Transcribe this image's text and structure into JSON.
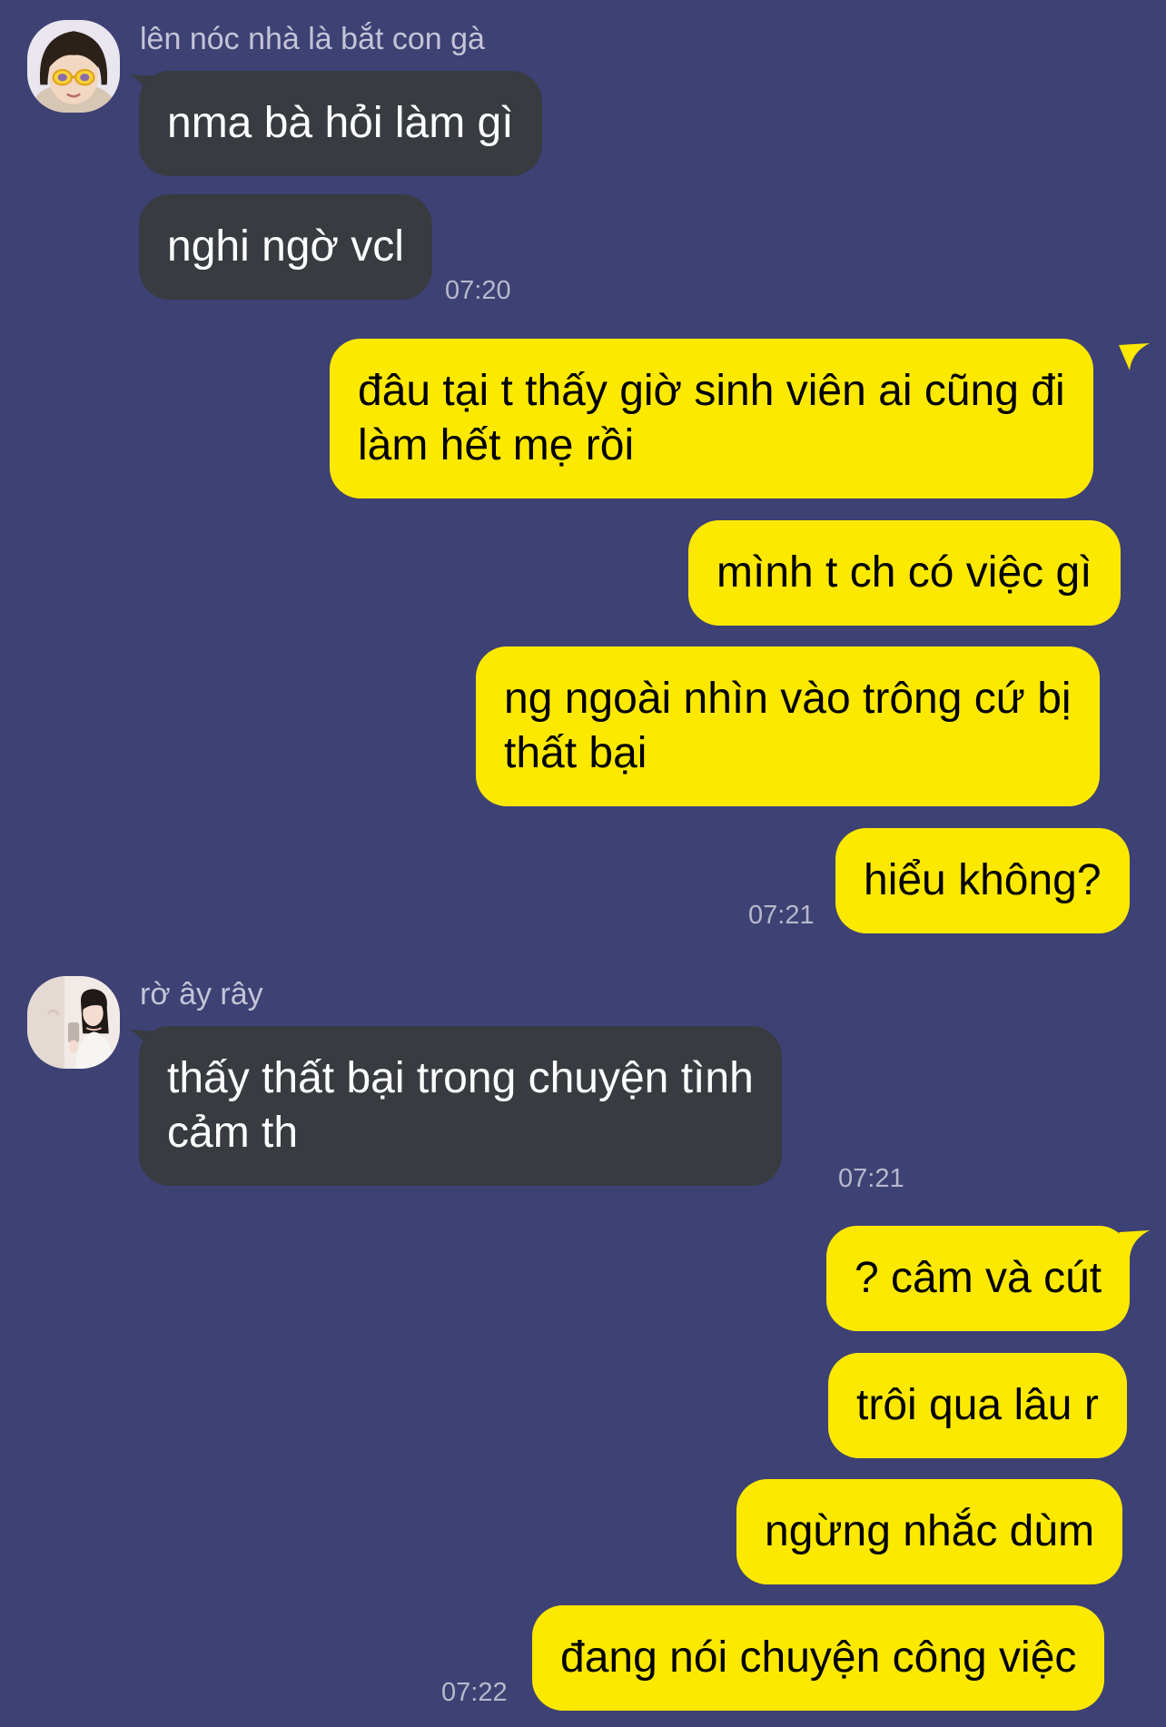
{
  "colors": {
    "background": "#3e4173",
    "incoming_bubble": "#383b40",
    "outgoing_bubble": "#fde900",
    "timestamp": "#b7b8cc",
    "sender_name": "#c3c4d8"
  },
  "groups": [
    {
      "direction": "incoming",
      "sender": "lên nóc nhà là bắt con gà",
      "avatar_icon": "girl-with-yellow-glasses-avatar",
      "messages": [
        {
          "text": "nma bà hỏi làm gì"
        },
        {
          "text": "nghi ngờ vcl"
        }
      ],
      "time": "07:20"
    },
    {
      "direction": "outgoing",
      "messages": [
        {
          "line1": "đâu tại t thấy giờ sinh viên ai cũng đi",
          "line2": "làm hết mẹ rồi"
        },
        {
          "text": "mình t ch có việc gì"
        },
        {
          "line1": "ng ngoài nhìn vào trông cứ bị",
          "line2": "thất bại"
        },
        {
          "text": "hiểu không?"
        }
      ],
      "time": "07:21"
    },
    {
      "direction": "incoming",
      "sender": "rờ ây rây",
      "avatar_icon": "girl-selfie-avatar",
      "messages": [
        {
          "line1": "thấy thất bại trong chuyện tình",
          "line2": "cảm th"
        }
      ],
      "time": "07:21"
    },
    {
      "direction": "outgoing",
      "messages": [
        {
          "text": "? câm và cút"
        },
        {
          "text": "trôi qua lâu r"
        },
        {
          "text": "ngừng nhắc dùm"
        },
        {
          "text": "đang nói chuyện công việc"
        }
      ],
      "time": "07:22"
    }
  ]
}
